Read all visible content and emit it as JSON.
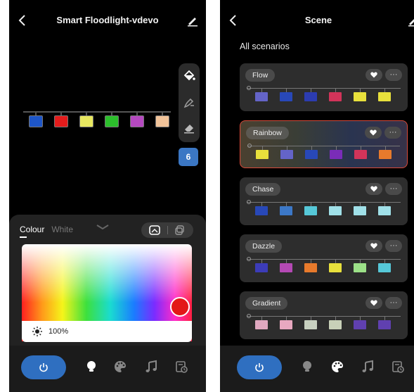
{
  "left": {
    "title": "Smart Floodlight-vdevo",
    "bulbs": [
      "#1e56c8",
      "#e31c1c",
      "#e8e860",
      "#2cbf2c",
      "#b549c0",
      "#f2c49a"
    ],
    "segment_count": "6",
    "tabs": [
      {
        "label": "Colour",
        "active": true
      },
      {
        "label": "White",
        "active": false
      }
    ],
    "brightness": "100%",
    "selected_color": "#e31818"
  },
  "right": {
    "title": "Scene",
    "section_label": "All scenarios",
    "scenes": [
      {
        "name": "Flow",
        "selected": false,
        "bulbs": [
          "#6464c8",
          "#2848b8",
          "#2c3cb0",
          "#d2345a",
          "#e8e03c",
          "#e8e03c"
        ]
      },
      {
        "name": "Rainbow",
        "selected": true,
        "bulbs": [
          "#e8e03c",
          "#6464c8",
          "#2848b8",
          "#7a2cb8",
          "#d2345a",
          "#e87a2c"
        ]
      },
      {
        "name": "Chase",
        "selected": false,
        "bulbs": [
          "#2848b8",
          "#3c78c8",
          "#56c8d8",
          "#a0e0e8",
          "#a0e0e8",
          "#a0e0e8"
        ]
      },
      {
        "name": "Dazzle",
        "selected": false,
        "bulbs": [
          "#3c3cb8",
          "#b449b4",
          "#e87a2c",
          "#e8e03c",
          "#9ce088",
          "#56c8d8"
        ]
      },
      {
        "name": "Gradient",
        "selected": false,
        "bulbs": [
          "#e0a8c0",
          "#e8a8c0",
          "#c8d0c0",
          "#c8d0b8",
          "#6040b0",
          "#6040b0"
        ]
      }
    ],
    "more_label": "···"
  },
  "colors": {
    "accent_blue": "#2f6fc0",
    "selected_border": "#d84a3a"
  }
}
